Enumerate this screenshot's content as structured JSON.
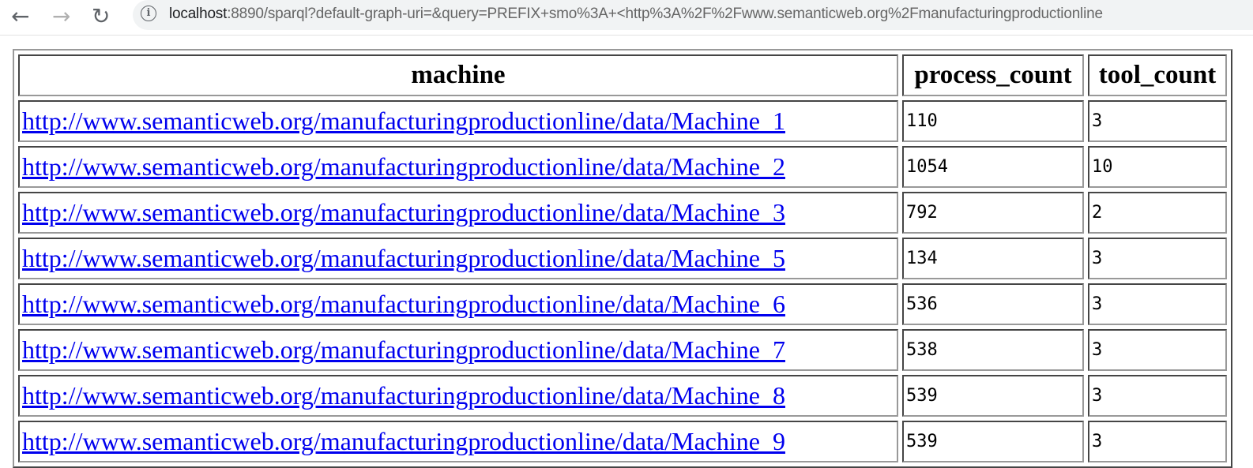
{
  "browser": {
    "back_icon": "arrow-left",
    "forward_icon": "arrow-right",
    "reload_icon": "reload",
    "info_icon": "info-circle",
    "url_host": "localhost",
    "url_rest": ":8890/sparql?default-graph-uri=&query=PREFIX+smo%3A+<http%3A%2F%2Fwww.semanticweb.org%2Fmanufacturingproductionline"
  },
  "table": {
    "headers": [
      "machine",
      "process_count",
      "tool_count"
    ],
    "rows": [
      {
        "machine": "http://www.semanticweb.org/manufacturingproductionline/data/Machine_1",
        "process_count": "110",
        "tool_count": "3"
      },
      {
        "machine": "http://www.semanticweb.org/manufacturingproductionline/data/Machine_2",
        "process_count": "1054",
        "tool_count": "10"
      },
      {
        "machine": "http://www.semanticweb.org/manufacturingproductionline/data/Machine_3",
        "process_count": "792",
        "tool_count": "2"
      },
      {
        "machine": "http://www.semanticweb.org/manufacturingproductionline/data/Machine_5",
        "process_count": "134",
        "tool_count": "3"
      },
      {
        "machine": "http://www.semanticweb.org/manufacturingproductionline/data/Machine_6",
        "process_count": "536",
        "tool_count": "3"
      },
      {
        "machine": "http://www.semanticweb.org/manufacturingproductionline/data/Machine_7",
        "process_count": "538",
        "tool_count": "3"
      },
      {
        "machine": "http://www.semanticweb.org/manufacturingproductionline/data/Machine_8",
        "process_count": "539",
        "tool_count": "3"
      },
      {
        "machine": "http://www.semanticweb.org/manufacturingproductionline/data/Machine_9",
        "process_count": "539",
        "tool_count": "3"
      }
    ]
  }
}
